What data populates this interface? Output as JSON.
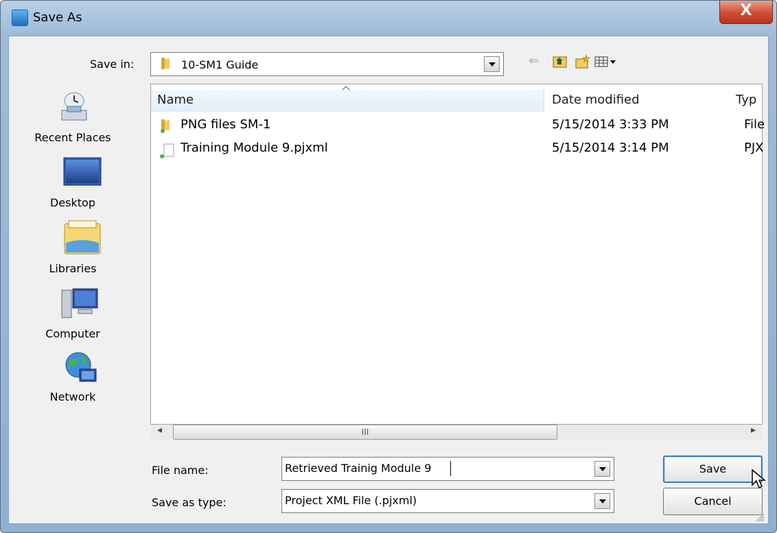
{
  "window": {
    "title": "Save As",
    "close_label": "X"
  },
  "location": {
    "label": "Save in:",
    "value": "10-SM1 Guide"
  },
  "places": [
    {
      "label": "Recent Places",
      "icon": "recent-places-icon"
    },
    {
      "label": "Desktop",
      "icon": "desktop-icon"
    },
    {
      "label": "Libraries",
      "icon": "libraries-icon"
    },
    {
      "label": "Computer",
      "icon": "computer-icon"
    },
    {
      "label": "Network",
      "icon": "network-icon"
    }
  ],
  "columns": {
    "name": "Name",
    "date": "Date modified",
    "type": "Typ"
  },
  "files": [
    {
      "name": "PNG files SM-1",
      "date": "5/15/2014 3:33 PM",
      "type": "File",
      "icon": "folder-icon"
    },
    {
      "name": "Training Module 9.pjxml",
      "date": "5/15/2014 3:14 PM",
      "type": "PJX",
      "icon": "file-icon"
    }
  ],
  "scroll": {
    "thumb_glyph": "III",
    "left_glyph": "◂",
    "right_glyph": "▸"
  },
  "filename": {
    "label": "File name:",
    "value": "Retrieved Trainig Module 9"
  },
  "filetype": {
    "label": "Save as type:",
    "value": "Project XML File (.pjxml)"
  },
  "buttons": {
    "save": "Save",
    "cancel": "Cancel"
  },
  "toolbar": {
    "back_glyph": "⇐",
    "up_glyph": "⤒",
    "new_glyph": "✱",
    "view_glyph": "☷▾"
  }
}
